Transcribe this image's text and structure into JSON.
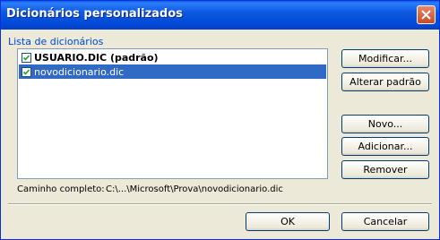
{
  "window": {
    "title": "Dicionários personalizados"
  },
  "list": {
    "label": "Lista de dicionários",
    "items": [
      {
        "label": "USUARIO.DIC (padrão)",
        "checked": true,
        "selected": false,
        "bold": true
      },
      {
        "label": "novodicionario.dic",
        "checked": true,
        "selected": true,
        "bold": false
      }
    ]
  },
  "buttons": {
    "modify": "Modificar...",
    "set_default": "Alterar padrão",
    "new": "Novo...",
    "add": "Adicionar...",
    "remove": "Remover",
    "ok": "OK",
    "cancel": "Cancelar"
  },
  "path": {
    "label": "Caminho completo:",
    "value": "C:\\...\\Microsoft\\Prova\\novodicionario.dic"
  },
  "icons": {
    "close": "close-icon",
    "checkbox": "checkmark-icon"
  },
  "colors": {
    "titlebar": "#0054e3",
    "selection": "#316ac5",
    "group_label": "#0046d5",
    "dialog_bg": "#ece9d8"
  }
}
